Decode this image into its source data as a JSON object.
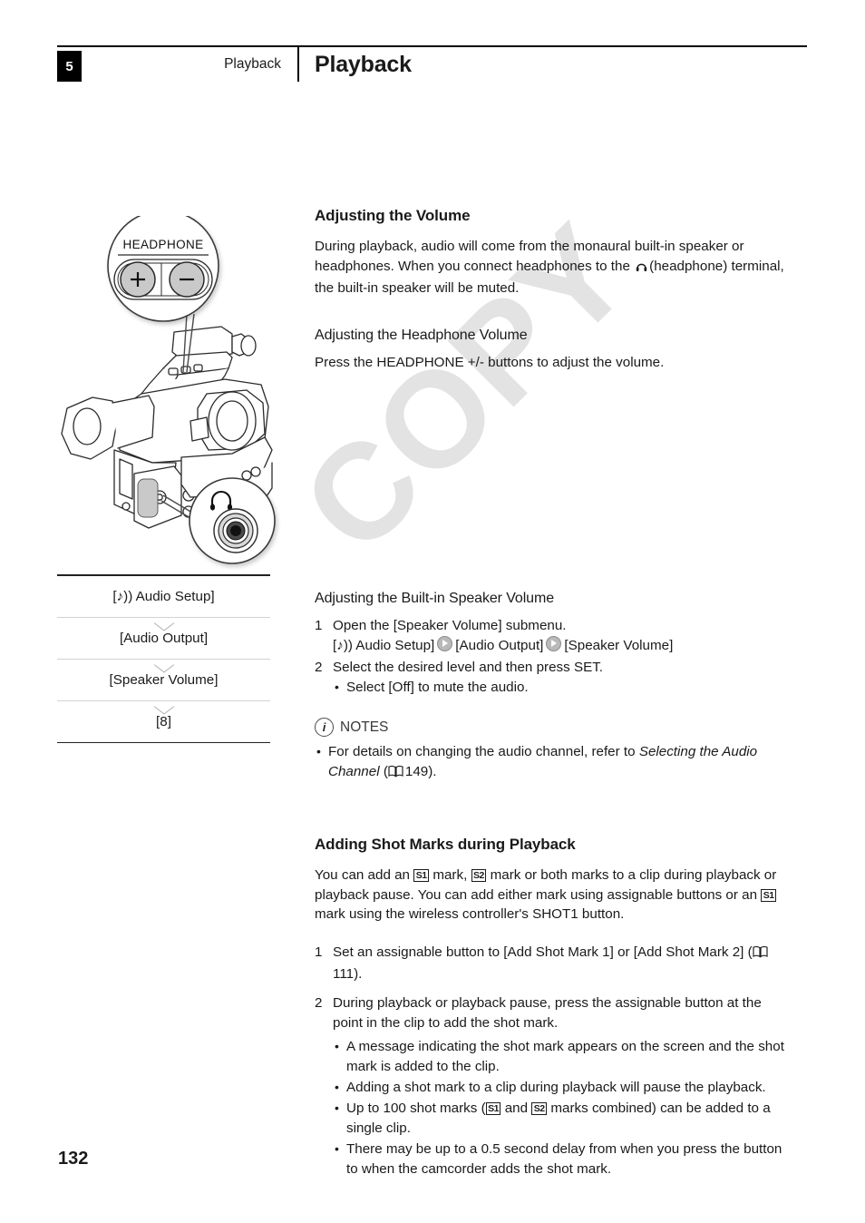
{
  "page": {
    "chapter_number": "5",
    "running_head": "Playback",
    "title": "Playback",
    "page_number": "132",
    "watermark": "COPY"
  },
  "illustration": {
    "callout_label": "HEADPHONE",
    "button_plus": "+",
    "button_minus": "−",
    "jack_icon": "headphone-icon",
    "camcorder_alt": "camcorder-line-drawing"
  },
  "menu_path": {
    "rows": [
      {
        "prefix": "♪))",
        "label": "[  Audio Setup]",
        "text": "[♪)) Audio Setup]"
      },
      {
        "text": "[Audio Output]"
      },
      {
        "text": "[Speaker Volume]"
      },
      {
        "text": "[8]"
      }
    ]
  },
  "sections": {
    "volume": {
      "heading": "Adjusting the Volume",
      "intro_a": "During playback, audio will come from the monaural built-in speaker or headphones. When you connect headphones to the",
      "intro_b": "(headphone) terminal, the built-in speaker will be muted."
    },
    "headphone": {
      "heading": "Adjusting the Headphone Volume",
      "body": "Press the HEADPHONE +/- buttons to adjust the volume."
    },
    "speaker": {
      "heading": "Adjusting the Built-in Speaker Volume",
      "step1_num": "1",
      "step1_text": "Open the [Speaker Volume] submenu.",
      "path_item1": "[♪)) Audio Setup]",
      "path_item2": "[Audio Output]",
      "path_item3": "[Speaker Volume]",
      "step2_num": "2",
      "step2_text": "Select the desired level and then press SET.",
      "step2_bullet": "Select [Off] to mute the audio."
    },
    "notes": {
      "label": "NOTES",
      "icon": "info-icon",
      "bullet_a": "For details on changing the audio channel, refer to",
      "bullet_italic": "Selecting the Audio Channel",
      "bullet_open_paren": "(",
      "bullet_page": "149).",
      "book_icon": "book-icon"
    },
    "shotmarks": {
      "heading": "Adding Shot Marks during Playback",
      "intro_a": "You can add an",
      "mark1": "S1",
      "intro_b": "mark,",
      "mark2": "S2",
      "intro_c": "mark or both marks to a clip during playback or playback pause. You can add either mark using assignable buttons or an",
      "mark3": "S1",
      "intro_d": "mark using the wireless controller's SHOT1 button.",
      "step1_num": "1",
      "step1_text": "Set an assignable button to [Add Shot Mark 1] or [Add Shot Mark 2]",
      "step1_ref_open": "(",
      "step1_ref_page": "111).",
      "step2_num": "2",
      "step2_text": "During playback or playback pause, press the assignable button at the point in the clip to add the shot mark.",
      "bullets": [
        "A message indicating the shot mark appears on the screen and the shot mark is added to the clip.",
        "Adding a shot mark to a clip during playback will pause the playback."
      ],
      "bullet_marks_a": "Up to 100 shot marks (",
      "bullet_marks_m1": "S1",
      "bullet_marks_b": "and",
      "bullet_marks_m2": "S2",
      "bullet_marks_c": "marks combined) can be added to a single clip.",
      "bullet_last": "There may be up to a 0.5 second delay from when you press the button to when the camcorder adds the shot mark."
    }
  }
}
